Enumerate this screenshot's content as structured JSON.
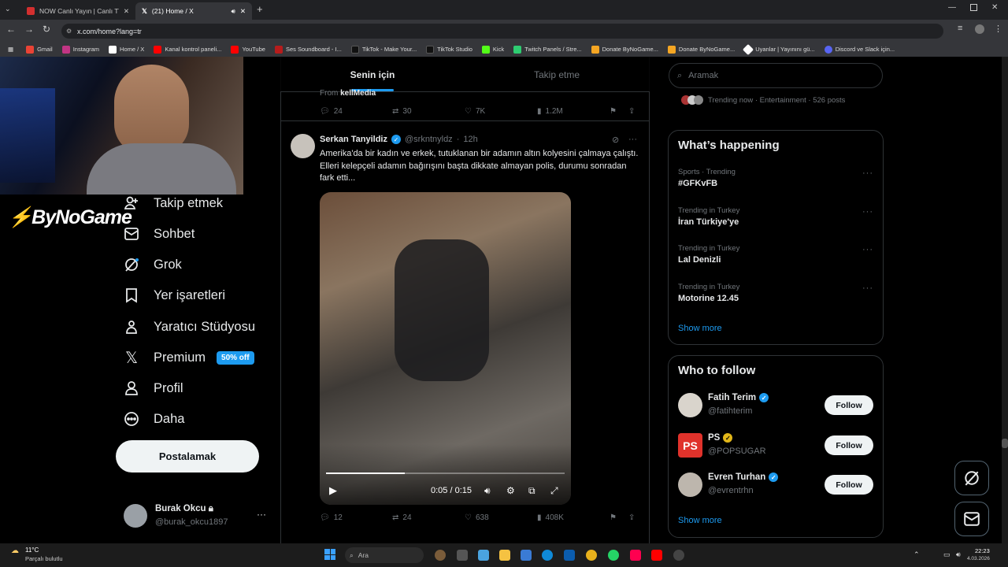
{
  "browser": {
    "tabs": [
      {
        "title": "NOW Canlı Yayın | Canlı TV İzle",
        "active": false
      },
      {
        "title": "(21) Home / X",
        "active": true
      }
    ],
    "url": "x.com/home?lang=tr",
    "bookmarks": [
      "Gmail",
      "Instagram",
      "Home / X",
      "Kanal kontrol paneli...",
      "YouTube",
      "Ses Soundboard - I...",
      "TikTok - Make Your...",
      "TikTok Studio",
      "Kick",
      "Twitch Panels / Stre...",
      "Donate ByNoGame...",
      "Donate ByNoGame...",
      "Uyanlar | Yayınını gü...",
      "Discord ve Slack için..."
    ]
  },
  "overlay": {
    "brand": "ByNoGame"
  },
  "nav": {
    "items": [
      {
        "label": "Takip etmek",
        "icon": "add-user-icon"
      },
      {
        "label": "Sohbet",
        "icon": "mail-icon"
      },
      {
        "label": "Grok",
        "icon": "grok-icon"
      },
      {
        "label": "Yer işaretleri",
        "icon": "bookmark-icon"
      },
      {
        "label": "Yaratıcı Stüdyosu",
        "icon": "studio-icon"
      },
      {
        "label": "Premium",
        "icon": "x-icon"
      },
      {
        "label": "Profil",
        "icon": "person-icon"
      },
      {
        "label": "Daha",
        "icon": "more-icon"
      }
    ],
    "premium_badge": "50% off",
    "post_label": "Postalamak",
    "account": {
      "name": "Burak Okcu",
      "handle": "@burak_okcu1897"
    }
  },
  "timeline": {
    "tabs": [
      "Senin için",
      "Takip etme"
    ],
    "prev": {
      "from_prefix": "From",
      "from_source": "kellMedia",
      "replies": "24",
      "reposts": "30",
      "likes": "7K",
      "views": "1.2M"
    },
    "tweet": {
      "name": "Serkan Tanyildiz",
      "handle": "@srkntnyldz",
      "time": "12h",
      "text": "Amerika'da bir kadın ve erkek, tutuklanan bir adamın altın kolyesini çalmaya çalıştı. Elleri kelepçeli adamın bağırışını başta dikkate almayan polis, durumu sonradan fark etti...",
      "video_time": "0:05 / 0:15",
      "video_progress": 0.33,
      "replies": "12",
      "reposts": "24",
      "likes": "638",
      "views": "408K"
    }
  },
  "right": {
    "search_placeholder": "Aramak",
    "trending_now": "Trending now · Entertainment · 526 posts",
    "happening_title": "What’s happening",
    "trends": [
      {
        "meta": "Sports · Trending",
        "name": "#GFKvFB"
      },
      {
        "meta": "Trending in Turkey",
        "name": "İran Türkiye'ye"
      },
      {
        "meta": "Trending in Turkey",
        "name": "Lal Denizli"
      },
      {
        "meta": "Trending in Turkey",
        "name": "Motorine 12.45"
      }
    ],
    "show_more": "Show more",
    "who_title": "Who to follow",
    "follows": [
      {
        "name": "Fatih Terim",
        "handle": "@fatihterim",
        "follow": "Follow"
      },
      {
        "name": "PS",
        "handle": "@POPSUGAR",
        "follow": "Follow"
      },
      {
        "name": "Evren Turhan",
        "handle": "@evrentrhn",
        "follow": "Follow"
      }
    ]
  },
  "taskbar": {
    "temp": "11°C",
    "weather": "Parçalı bulutlu",
    "search": "Ara",
    "time": "22:23",
    "date": "4.03.2026"
  }
}
